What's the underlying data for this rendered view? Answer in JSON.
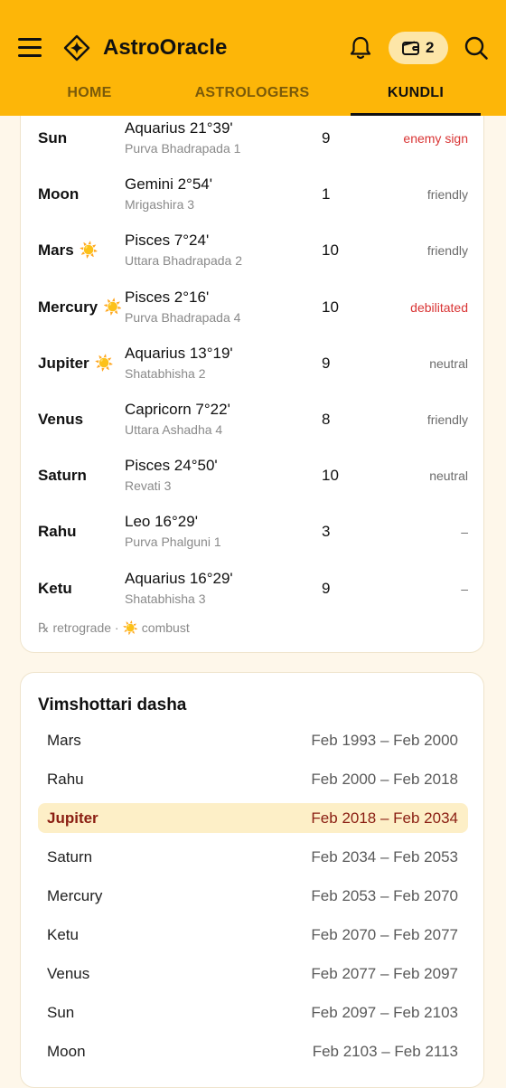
{
  "app": {
    "title": "AstroOracle",
    "wallet_count": "2",
    "icons": [
      "menu-icon",
      "astro-logo-icon",
      "bell-icon",
      "wallet-icon",
      "search-icon"
    ],
    "accent_color": "#FDB608"
  },
  "tabs": [
    {
      "label": "HOME"
    },
    {
      "label": "ASTROLOGERS"
    },
    {
      "label": "KUNDLI",
      "active": true
    }
  ],
  "planets": [
    {
      "name": "Sun",
      "combust": "",
      "sign": "Aquarius 21°39'",
      "nakshatra": "Purva Bhadrapada 1",
      "house": "9",
      "dignity": "enemy sign",
      "dignity_color": "#D93434"
    },
    {
      "name": "Moon",
      "combust": "",
      "sign": "Gemini 2°54'",
      "nakshatra": "Mrigashira 3",
      "house": "1",
      "dignity": "friendly",
      "dignity_color": "#6b6b6b"
    },
    {
      "name": "Mars",
      "combust": "☀️",
      "sign": "Pisces 7°24'",
      "nakshatra": "Uttara Bhadrapada 2",
      "house": "10",
      "dignity": "friendly",
      "dignity_color": "#6b6b6b"
    },
    {
      "name": "Mercury",
      "combust": "☀️",
      "sign": "Pisces 2°16'",
      "nakshatra": "Purva Bhadrapada 4",
      "house": "10",
      "dignity": "debilitated",
      "dignity_color": "#D93434"
    },
    {
      "name": "Jupiter",
      "combust": "☀️",
      "sign": "Aquarius 13°19'",
      "nakshatra": "Shatabhisha 2",
      "house": "9",
      "dignity": "neutral",
      "dignity_color": "#6b6b6b"
    },
    {
      "name": "Venus",
      "combust": "",
      "sign": "Capricorn 7°22'",
      "nakshatra": "Uttara Ashadha 4",
      "house": "8",
      "dignity": "friendly",
      "dignity_color": "#6b6b6b"
    },
    {
      "name": "Saturn",
      "combust": "",
      "sign": "Pisces 24°50'",
      "nakshatra": "Revati 3",
      "house": "10",
      "dignity": "neutral",
      "dignity_color": "#6b6b6b"
    },
    {
      "name": "Rahu",
      "combust": "",
      "sign": "Leo 16°29'",
      "nakshatra": "Purva Phalguni 1",
      "house": "3",
      "dignity": "–",
      "dignity_color": "#6b6b6b"
    },
    {
      "name": "Ketu",
      "combust": "",
      "sign": "Aquarius 16°29'",
      "nakshatra": "Shatabhisha 3",
      "house": "9",
      "dignity": "–",
      "dignity_color": "#6b6b6b"
    }
  ],
  "legend": {
    "retro": "℞ retrograde · ",
    "combust_symbol": "☀️",
    "combust_text": " combust"
  },
  "dasha": {
    "title": "Vimshottari dasha",
    "periods": [
      {
        "planet": "Mars",
        "range": "Feb 1993 – Feb 2000"
      },
      {
        "planet": "Rahu",
        "range": "Feb 2000 – Feb 2018"
      },
      {
        "planet": "Jupiter",
        "range": "Feb 2018 – Feb 2034",
        "current": true
      },
      {
        "planet": "Saturn",
        "range": "Feb 2034 – Feb 2053"
      },
      {
        "planet": "Mercury",
        "range": "Feb 2053 – Feb 2070"
      },
      {
        "planet": "Ketu",
        "range": "Feb 2070 – Feb 2077"
      },
      {
        "planet": "Venus",
        "range": "Feb 2077 – Feb 2097"
      },
      {
        "planet": "Sun",
        "range": "Feb 2097 – Feb 2103"
      },
      {
        "planet": "Moon",
        "range": "Feb 2103 – Feb 2113"
      }
    ]
  }
}
